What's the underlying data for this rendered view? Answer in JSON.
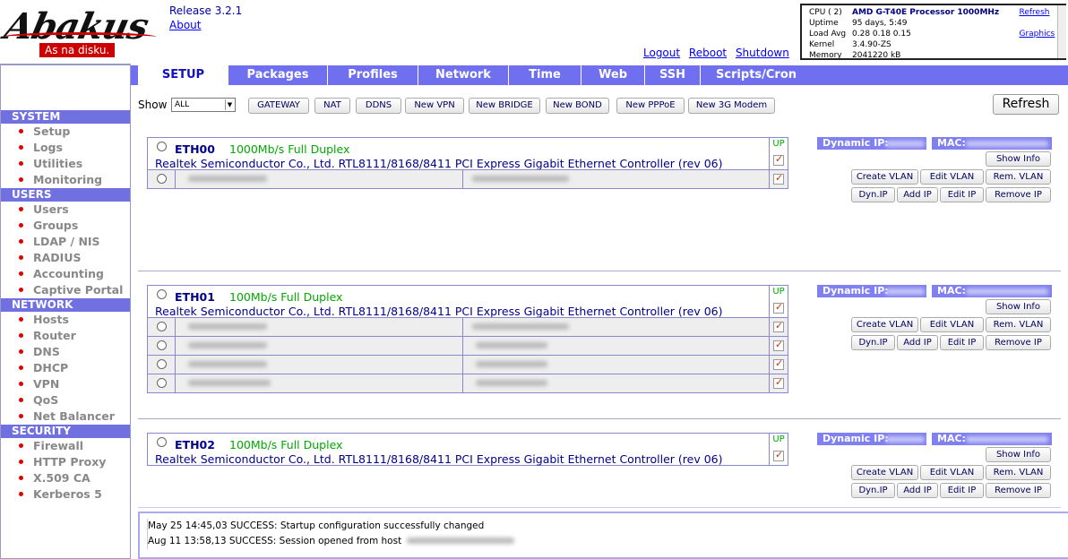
{
  "header": {
    "logo_text": "Abakus",
    "slogan": "As na disku.",
    "release": "Release 3.2.1",
    "about": "About",
    "links": [
      "Logout",
      "Reboot",
      "Shutdown"
    ]
  },
  "sysinfo": {
    "cpu_label": "CPU ( 2)",
    "cpu_value": "AMD G-T40E Processor 1000MHz",
    "uptime_label": "Uptime",
    "uptime_value": "95 days, 5:49",
    "load_label": "Load Avg",
    "load_value": "0.28 0.18 0.15",
    "kernel_label": "Kernel",
    "kernel_value": "3.4.90-ZS",
    "memory_label": "Memory",
    "memory_value": "2041220 kB",
    "refresh_link": "Refresh",
    "graphics_link": "Graphics"
  },
  "sidebar": [
    {
      "heading": "SYSTEM",
      "items": [
        "Setup",
        "Logs",
        "Utilities",
        "Monitoring"
      ]
    },
    {
      "heading": "USERS",
      "items": [
        "Users",
        "Groups",
        "LDAP / NIS",
        "RADIUS",
        "Accounting",
        "Captive Portal"
      ]
    },
    {
      "heading": "NETWORK",
      "items": [
        "Hosts",
        "Router",
        "DNS",
        "DHCP",
        "VPN",
        "QoS",
        "Net Balancer"
      ]
    },
    {
      "heading": "SECURITY",
      "items": [
        "Firewall",
        "HTTP Proxy",
        "X.509 CA",
        "Kerberos 5"
      ]
    }
  ],
  "tabs": [
    {
      "label": "SETUP",
      "active": true
    },
    {
      "label": "Packages",
      "active": false
    },
    {
      "label": "Profiles",
      "active": false
    },
    {
      "label": "Network",
      "active": false
    },
    {
      "label": "Time",
      "active": false
    },
    {
      "label": "Web",
      "active": false
    },
    {
      "label": "SSH",
      "active": false
    },
    {
      "label": "Scripts/Cron",
      "active": false
    }
  ],
  "toolbar": {
    "show_label": "Show",
    "show_value": "ALL",
    "buttons": [
      "GATEWAY",
      "NAT",
      "DDNS",
      "New VPN",
      "New BRIDGE",
      "New BOND",
      "New PPPoE",
      "New 3G Modem"
    ],
    "refresh": "Refresh"
  },
  "interfaces": [
    {
      "name": "ETH00",
      "speed": "1000Mb/s Full Duplex",
      "desc": "Realtek Semiconductor Co., Ltd. RTL8111/8168/8411 PCI Express Gigabit Ethernet Controller (rev 06)",
      "status": "UP",
      "subrows": 1
    },
    {
      "name": "ETH01",
      "speed": "100Mb/s Full Duplex",
      "desc": "Realtek Semiconductor Co., Ltd. RTL8111/8168/8411 PCI Express Gigabit Ethernet Controller (rev 06)",
      "status": "UP",
      "subrows": 4
    },
    {
      "name": "ETH02",
      "speed": "100Mb/s Full Duplex",
      "desc": "Realtek Semiconductor Co., Ltd. RTL8111/8168/8411 PCI Express Gigabit Ethernet Controller (rev 06)",
      "status": "UP",
      "subrows": 0
    }
  ],
  "iface_panel": {
    "dynamic_ip_label": "Dynamic IP:",
    "mac_label": "MAC:",
    "show_info": "Show Info",
    "create_vlan": "Create VLAN",
    "edit_vlan": "Edit VLAN",
    "rem_vlan": "Rem. VLAN",
    "dyn_ip": "Dyn.IP",
    "add_ip": "Add IP",
    "edit_ip": "Edit IP",
    "remove_ip": "Remove IP"
  },
  "log": [
    "May 25 14:45,03 SUCCESS: Startup configuration successfully changed",
    "Aug 11 13:58,13 SUCCESS: Session opened from host"
  ]
}
